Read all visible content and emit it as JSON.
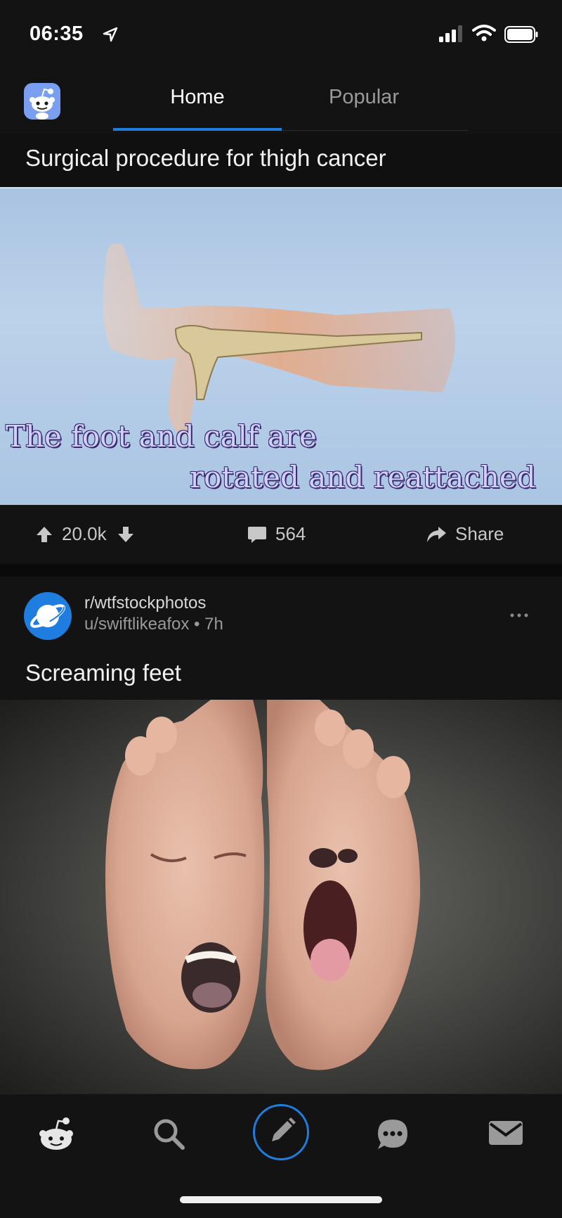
{
  "status_bar": {
    "time": "06:35",
    "icons": [
      "location-arrow-icon",
      "signal-icon",
      "wifi-icon",
      "battery-icon"
    ]
  },
  "header": {
    "tabs": [
      {
        "label": "Home",
        "active": true
      },
      {
        "label": "Popular",
        "active": false
      }
    ],
    "accent_color": "#1f7de0"
  },
  "feed": {
    "post1": {
      "title": "Surgical procedure for thigh cancer",
      "image_caption": [
        "The foot and calf are",
        "rotated and reattached"
      ],
      "upvotes": "20.0k",
      "comments": "564",
      "share_label": "Share"
    },
    "post2": {
      "subreddit": "r/wtfstockphotos",
      "byline": "u/swiftlikeafox • 7h",
      "title": "Screaming feet"
    }
  },
  "tab_bar": {
    "items": [
      "home-icon",
      "search-icon",
      "compose-icon",
      "chat-icon",
      "inbox-icon"
    ]
  },
  "colors": {
    "background": "#101010",
    "card": "#131313",
    "accent": "#1f7de0"
  }
}
